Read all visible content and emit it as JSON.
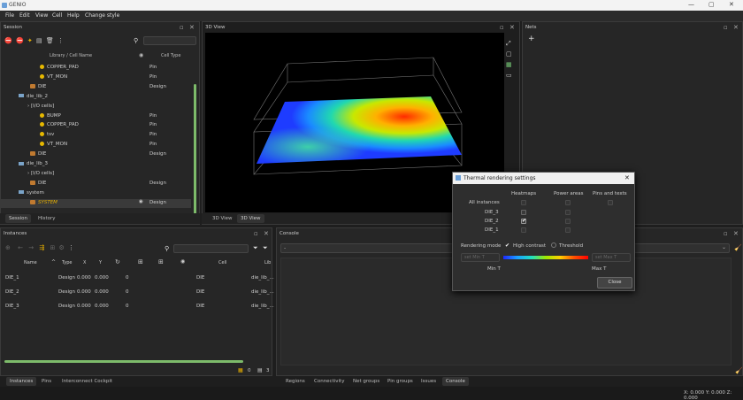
{
  "app": {
    "title": "GENIO",
    "min": "—",
    "max": "▢",
    "close": "✕"
  },
  "menu": [
    "File",
    "Edit",
    "View",
    "Cell",
    "Help",
    "Change style"
  ],
  "session": {
    "title": "Session",
    "col_name": "Library / Cell Name",
    "col_type": "Cell Type",
    "rows": [
      {
        "label": "COPPER_PAD",
        "type": "Pin",
        "kind": "pin",
        "indent": 44
      },
      {
        "label": "VT_MON",
        "type": "Pin",
        "kind": "pin",
        "indent": 44
      },
      {
        "label": "DIE",
        "type": "Design",
        "kind": "die",
        "indent": 33
      },
      {
        "label": "die_lib_2",
        "type": "",
        "kind": "lib",
        "indent": 20
      },
      {
        "label": "[I/O cells]",
        "type": "",
        "kind": "group",
        "indent": 30
      },
      {
        "label": "BUMP",
        "type": "Pin",
        "kind": "pin",
        "indent": 44
      },
      {
        "label": "COPPER_PAD",
        "type": "Pin",
        "kind": "pin",
        "indent": 44
      },
      {
        "label": "tsv",
        "type": "Pin",
        "kind": "pin",
        "indent": 44
      },
      {
        "label": "VT_MON",
        "type": "Pin",
        "kind": "pin",
        "indent": 44
      },
      {
        "label": "DIE",
        "type": "Design",
        "kind": "die",
        "indent": 33
      },
      {
        "label": "die_lib_3",
        "type": "",
        "kind": "lib",
        "indent": 20
      },
      {
        "label": "[I/O cells]",
        "type": "",
        "kind": "group",
        "indent": 30
      },
      {
        "label": "DIE",
        "type": "Design",
        "kind": "die",
        "indent": 33
      },
      {
        "label": "system",
        "type": "",
        "kind": "lib",
        "indent": 20
      },
      {
        "label": "SYSTEM",
        "type": "Design",
        "kind": "die",
        "indent": 33
      }
    ],
    "tabs": [
      "Session",
      "History"
    ]
  },
  "view3d": {
    "title": "3D View",
    "tabs": [
      "3D View",
      "3D View"
    ]
  },
  "nets": {
    "title": "Nets",
    "add": "+"
  },
  "instances": {
    "title": "Instances",
    "columns": [
      "Name",
      "Type",
      "X",
      "Y",
      "",
      "",
      "",
      "",
      "Cell",
      "Lib"
    ],
    "rows": [
      {
        "name": "DIE_1",
        "type": "Design",
        "x": "0.000",
        "y": "0.000",
        "rot": "0",
        "cell": "DIE",
        "lib": "die_lib_..."
      },
      {
        "name": "DIE_2",
        "type": "Design",
        "x": "0.000",
        "y": "0.000",
        "rot": "0",
        "cell": "DIE",
        "lib": "die_lib_..."
      },
      {
        "name": "DIE_3",
        "type": "Design",
        "x": "0.000",
        "y": "0.000",
        "rot": "0",
        "cell": "DIE",
        "lib": "die_lib_..."
      }
    ],
    "count_a": "0",
    "count_b": "3"
  },
  "console": {
    "title": "Console",
    "input": "-"
  },
  "bottom_tabs_left": [
    "Instances",
    "Pins",
    "Interconnect Cockpit"
  ],
  "bottom_tabs_right": [
    "Regions",
    "Connectivity",
    "Net groups",
    "Pin groups",
    "Issues",
    "Console"
  ],
  "status": "X: 0.000 Y: 0.000 Z: 0.000",
  "dialog": {
    "title": "Thermal rendering settings",
    "col_heatmaps": "Heatmaps",
    "col_power": "Power areas",
    "col_pins": "Pins and texts",
    "rows": [
      "All instances",
      "DIE_3",
      "DIE_2",
      "DIE_1"
    ],
    "mode_label": "Rendering mode",
    "high_contrast": "High contrast",
    "threshold": "Threshold",
    "min_ph": "set Min T",
    "max_ph": "set Max T",
    "min_label": "Min T",
    "max_label": "Max T",
    "close": "Close"
  }
}
